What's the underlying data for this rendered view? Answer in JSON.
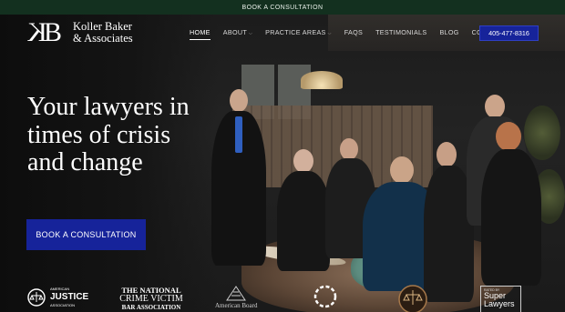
{
  "topbar": {
    "label": "BOOK A CONSULTATION"
  },
  "logo": {
    "mark": "KB",
    "line1": "Koller Baker",
    "line2": "& Associates"
  },
  "nav": {
    "items": [
      {
        "label": "HOME",
        "active": true
      },
      {
        "label": "ABOUT",
        "has_dropdown": true
      },
      {
        "label": "PRACTICE AREAS",
        "has_dropdown": true
      },
      {
        "label": "FAQS"
      },
      {
        "label": "TESTIMONIALS"
      },
      {
        "label": "BLOG"
      },
      {
        "label": "CONTACT"
      }
    ],
    "phone": "405-477-8316"
  },
  "hero": {
    "headline": "Your lawyers in times of crisis and change",
    "cta": "BOOK A CONSULTATION"
  },
  "badges": {
    "justice_small": "AMERICAN",
    "justice": "JUSTICE",
    "justice_sub": "ASSOCIATION",
    "crime_victim_line1": "THE NATIONAL",
    "crime_victim_line2": "CRIME VICTIM",
    "crime_victim_line3": "BAR ASSOCIATION",
    "american_board": "American Board",
    "rated_by": "RATED BY",
    "super": "Super",
    "lawyers": "Lawyers"
  },
  "colors": {
    "topbar_bg": "#13301f",
    "accent_blue": "#16239a",
    "page_bg": "#141414"
  }
}
